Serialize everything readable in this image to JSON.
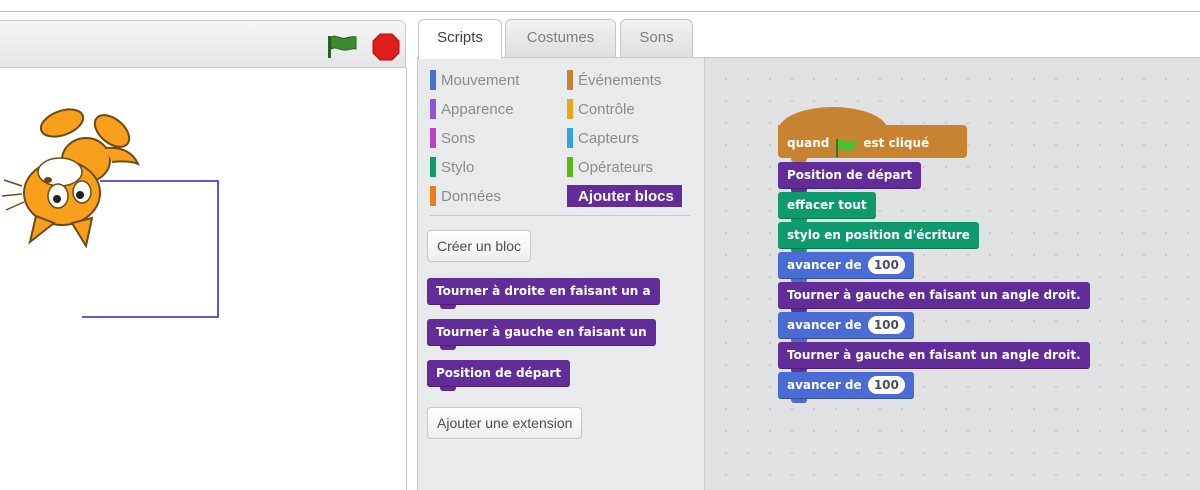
{
  "tabs": [
    {
      "label": "Scripts",
      "active": true
    },
    {
      "label": "Costumes",
      "active": false
    },
    {
      "label": "Sons",
      "active": false
    }
  ],
  "categories": [
    {
      "label": "Mouvement",
      "color": "#4a6cd4"
    },
    {
      "label": "Apparence",
      "color": "#8a55d7"
    },
    {
      "label": "Sons",
      "color": "#bb42c3"
    },
    {
      "label": "Stylo",
      "color": "#0e9a6c"
    },
    {
      "label": "Données",
      "color": "#ee7d16"
    },
    {
      "label": "Événements",
      "color": "#c88330"
    },
    {
      "label": "Contrôle",
      "color": "#e1a91a"
    },
    {
      "label": "Capteurs",
      "color": "#2ca5e2"
    },
    {
      "label": "Opérateurs",
      "color": "#5cb712"
    },
    {
      "label": "Ajouter blocs",
      "color": "#632d99",
      "selected": true
    }
  ],
  "palette": {
    "make_block_label": "Créer un bloc",
    "blocks": [
      "Tourner à droite en faisant un a",
      "Tourner à gauche en faisant un",
      "Position de départ"
    ],
    "add_extension_label": "Ajouter une extension"
  },
  "script": {
    "hat": {
      "before": "quand",
      "after": "est cliqué"
    },
    "blocks": [
      {
        "text": "Position de départ",
        "color": "purple"
      },
      {
        "text": "effacer tout",
        "color": "green"
      },
      {
        "text": "stylo en position d'écriture",
        "color": "green"
      },
      {
        "text": "avancer de",
        "value": "100",
        "color": "blue"
      },
      {
        "text": "Tourner à gauche en faisant un angle droit.",
        "color": "purple"
      },
      {
        "text": "avancer de",
        "value": "100",
        "color": "blue"
      },
      {
        "text": "Tourner à gauche en faisant un angle droit.",
        "color": "purple"
      },
      {
        "text": "avancer de",
        "value": "100",
        "color": "blue"
      }
    ]
  },
  "colors": {
    "flag_green": "#3d8a2f",
    "stop_red": "#e11c1c",
    "pen_line": "#2324c8",
    "sprite_orange": "#f8a01b"
  },
  "icons": {
    "green_flag": "green-flag-icon",
    "stop": "stop-icon",
    "sprite": "scratch-cat-sprite"
  }
}
